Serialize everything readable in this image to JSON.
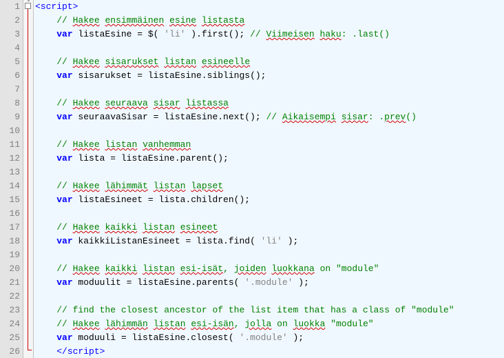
{
  "lines": [
    {
      "num": 1,
      "segs": [
        {
          "cls": "t-tag",
          "txt": "<script>"
        }
      ]
    },
    {
      "num": 2,
      "segs": [
        {
          "cls": "t-plain",
          "txt": "    "
        },
        {
          "cls": "t-com",
          "txt": "// "
        },
        {
          "cls": "t-com squiggle",
          "txt": "Hakee"
        },
        {
          "cls": "t-com",
          "txt": " "
        },
        {
          "cls": "t-com squiggle",
          "txt": "ensimmäinen"
        },
        {
          "cls": "t-com",
          "txt": " "
        },
        {
          "cls": "t-com squiggle",
          "txt": "esine"
        },
        {
          "cls": "t-com",
          "txt": " "
        },
        {
          "cls": "t-com squiggle",
          "txt": "listasta"
        }
      ]
    },
    {
      "num": 3,
      "segs": [
        {
          "cls": "t-plain",
          "txt": "    "
        },
        {
          "cls": "t-key",
          "txt": "var"
        },
        {
          "cls": "t-plain",
          "txt": " listaEsine = $( "
        },
        {
          "cls": "t-str",
          "txt": "'li'"
        },
        {
          "cls": "t-plain",
          "txt": " ).first(); "
        },
        {
          "cls": "t-com",
          "txt": "// "
        },
        {
          "cls": "t-com squiggle",
          "txt": "Viimeisen"
        },
        {
          "cls": "t-com",
          "txt": " "
        },
        {
          "cls": "t-com squiggle",
          "txt": "haku"
        },
        {
          "cls": "t-com",
          "txt": ": .last()"
        }
      ]
    },
    {
      "num": 4,
      "segs": [
        {
          "cls": "t-plain",
          "txt": ""
        }
      ]
    },
    {
      "num": 5,
      "segs": [
        {
          "cls": "t-plain",
          "txt": "    "
        },
        {
          "cls": "t-com",
          "txt": "// "
        },
        {
          "cls": "t-com squiggle",
          "txt": "Hakee"
        },
        {
          "cls": "t-com",
          "txt": " "
        },
        {
          "cls": "t-com squiggle",
          "txt": "sisarukset"
        },
        {
          "cls": "t-com",
          "txt": " "
        },
        {
          "cls": "t-com squiggle",
          "txt": "listan"
        },
        {
          "cls": "t-com",
          "txt": " "
        },
        {
          "cls": "t-com squiggle",
          "txt": "esineelle"
        }
      ]
    },
    {
      "num": 6,
      "segs": [
        {
          "cls": "t-plain",
          "txt": "    "
        },
        {
          "cls": "t-key",
          "txt": "var"
        },
        {
          "cls": "t-plain",
          "txt": " sisarukset = listaEsine.siblings();"
        }
      ]
    },
    {
      "num": 7,
      "segs": [
        {
          "cls": "t-plain",
          "txt": ""
        }
      ]
    },
    {
      "num": 8,
      "segs": [
        {
          "cls": "t-plain",
          "txt": "    "
        },
        {
          "cls": "t-com",
          "txt": "// "
        },
        {
          "cls": "t-com squiggle",
          "txt": "Hakee"
        },
        {
          "cls": "t-com",
          "txt": " "
        },
        {
          "cls": "t-com squiggle",
          "txt": "seuraava"
        },
        {
          "cls": "t-com",
          "txt": " "
        },
        {
          "cls": "t-com squiggle",
          "txt": "sisar"
        },
        {
          "cls": "t-com",
          "txt": " "
        },
        {
          "cls": "t-com squiggle",
          "txt": "listassa"
        }
      ]
    },
    {
      "num": 9,
      "segs": [
        {
          "cls": "t-plain",
          "txt": "    "
        },
        {
          "cls": "t-key",
          "txt": "var"
        },
        {
          "cls": "t-plain",
          "txt": " seuraavaSisar = listaEsine.next(); "
        },
        {
          "cls": "t-com",
          "txt": "// "
        },
        {
          "cls": "t-com squiggle",
          "txt": "Aikaisempi"
        },
        {
          "cls": "t-com",
          "txt": " "
        },
        {
          "cls": "t-com squiggle",
          "txt": "sisar"
        },
        {
          "cls": "t-com",
          "txt": ": ."
        },
        {
          "cls": "t-com squiggle",
          "txt": "prev"
        },
        {
          "cls": "t-com",
          "txt": "()"
        }
      ]
    },
    {
      "num": 10,
      "segs": [
        {
          "cls": "t-plain",
          "txt": ""
        }
      ]
    },
    {
      "num": 11,
      "segs": [
        {
          "cls": "t-plain",
          "txt": "    "
        },
        {
          "cls": "t-com",
          "txt": "// "
        },
        {
          "cls": "t-com squiggle",
          "txt": "Hakee"
        },
        {
          "cls": "t-com",
          "txt": " "
        },
        {
          "cls": "t-com squiggle",
          "txt": "listan"
        },
        {
          "cls": "t-com",
          "txt": " "
        },
        {
          "cls": "t-com squiggle",
          "txt": "vanhemman"
        }
      ]
    },
    {
      "num": 12,
      "segs": [
        {
          "cls": "t-plain",
          "txt": "    "
        },
        {
          "cls": "t-key",
          "txt": "var"
        },
        {
          "cls": "t-plain",
          "txt": " lista = listaEsine.parent();"
        }
      ]
    },
    {
      "num": 13,
      "segs": [
        {
          "cls": "t-plain",
          "txt": ""
        }
      ]
    },
    {
      "num": 14,
      "segs": [
        {
          "cls": "t-plain",
          "txt": "    "
        },
        {
          "cls": "t-com",
          "txt": "// "
        },
        {
          "cls": "t-com squiggle",
          "txt": "Hakee"
        },
        {
          "cls": "t-com",
          "txt": " "
        },
        {
          "cls": "t-com squiggle",
          "txt": "lähimmät"
        },
        {
          "cls": "t-com",
          "txt": " "
        },
        {
          "cls": "t-com squiggle",
          "txt": "listan"
        },
        {
          "cls": "t-com",
          "txt": " "
        },
        {
          "cls": "t-com squiggle",
          "txt": "lapset"
        }
      ]
    },
    {
      "num": 15,
      "segs": [
        {
          "cls": "t-plain",
          "txt": "    "
        },
        {
          "cls": "t-key",
          "txt": "var"
        },
        {
          "cls": "t-plain",
          "txt": " listaEsineet = lista.children();"
        }
      ]
    },
    {
      "num": 16,
      "segs": [
        {
          "cls": "t-plain",
          "txt": ""
        }
      ]
    },
    {
      "num": 17,
      "segs": [
        {
          "cls": "t-plain",
          "txt": "    "
        },
        {
          "cls": "t-com",
          "txt": "// "
        },
        {
          "cls": "t-com squiggle",
          "txt": "Hakee"
        },
        {
          "cls": "t-com",
          "txt": " "
        },
        {
          "cls": "t-com squiggle",
          "txt": "kaikki"
        },
        {
          "cls": "t-com",
          "txt": " "
        },
        {
          "cls": "t-com squiggle",
          "txt": "listan"
        },
        {
          "cls": "t-com",
          "txt": " "
        },
        {
          "cls": "t-com squiggle",
          "txt": "esineet"
        }
      ]
    },
    {
      "num": 18,
      "segs": [
        {
          "cls": "t-plain",
          "txt": "    "
        },
        {
          "cls": "t-key",
          "txt": "var"
        },
        {
          "cls": "t-plain",
          "txt": " kaikkiListanEsineet = lista.find( "
        },
        {
          "cls": "t-str",
          "txt": "'li'"
        },
        {
          "cls": "t-plain",
          "txt": " );"
        }
      ]
    },
    {
      "num": 19,
      "segs": [
        {
          "cls": "t-plain",
          "txt": ""
        }
      ]
    },
    {
      "num": 20,
      "segs": [
        {
          "cls": "t-plain",
          "txt": "    "
        },
        {
          "cls": "t-com",
          "txt": "// "
        },
        {
          "cls": "t-com squiggle",
          "txt": "Hakee"
        },
        {
          "cls": "t-com",
          "txt": " "
        },
        {
          "cls": "t-com squiggle",
          "txt": "kaikki"
        },
        {
          "cls": "t-com",
          "txt": " "
        },
        {
          "cls": "t-com squiggle",
          "txt": "listan"
        },
        {
          "cls": "t-com",
          "txt": " "
        },
        {
          "cls": "t-com squiggle",
          "txt": "esi-isät"
        },
        {
          "cls": "t-com",
          "txt": ", "
        },
        {
          "cls": "t-com squiggle",
          "txt": "joiden"
        },
        {
          "cls": "t-com",
          "txt": " "
        },
        {
          "cls": "t-com squiggle",
          "txt": "luokkana"
        },
        {
          "cls": "t-com",
          "txt": " on \"module\""
        }
      ]
    },
    {
      "num": 21,
      "segs": [
        {
          "cls": "t-plain",
          "txt": "    "
        },
        {
          "cls": "t-key",
          "txt": "var"
        },
        {
          "cls": "t-plain",
          "txt": " moduulit = listaEsine.parents( "
        },
        {
          "cls": "t-str",
          "txt": "'.module'"
        },
        {
          "cls": "t-plain",
          "txt": " );"
        }
      ]
    },
    {
      "num": 22,
      "segs": [
        {
          "cls": "t-plain",
          "txt": ""
        }
      ]
    },
    {
      "num": 23,
      "segs": [
        {
          "cls": "t-plain",
          "txt": "    "
        },
        {
          "cls": "t-com",
          "txt": "// find the closest ancestor of the list item that has a class of \"module\""
        }
      ]
    },
    {
      "num": 24,
      "segs": [
        {
          "cls": "t-plain",
          "txt": "    "
        },
        {
          "cls": "t-com",
          "txt": "// "
        },
        {
          "cls": "t-com squiggle",
          "txt": "Hakee"
        },
        {
          "cls": "t-com",
          "txt": " "
        },
        {
          "cls": "t-com squiggle",
          "txt": "lähimmän"
        },
        {
          "cls": "t-com",
          "txt": " "
        },
        {
          "cls": "t-com squiggle",
          "txt": "listan"
        },
        {
          "cls": "t-com",
          "txt": " "
        },
        {
          "cls": "t-com squiggle",
          "txt": "esi-isän"
        },
        {
          "cls": "t-com",
          "txt": ", "
        },
        {
          "cls": "t-com squiggle",
          "txt": "jolla"
        },
        {
          "cls": "t-com",
          "txt": " on "
        },
        {
          "cls": "t-com squiggle",
          "txt": "luokka"
        },
        {
          "cls": "t-com",
          "txt": " \"module\""
        }
      ]
    },
    {
      "num": 25,
      "segs": [
        {
          "cls": "t-plain",
          "txt": "    "
        },
        {
          "cls": "t-key",
          "txt": "var"
        },
        {
          "cls": "t-plain",
          "txt": " moduuli = listaEsine.closest( "
        },
        {
          "cls": "t-str",
          "txt": "'.module'"
        },
        {
          "cls": "t-plain",
          "txt": " );"
        }
      ]
    },
    {
      "num": 26,
      "segs": [
        {
          "cls": "t-plain",
          "txt": "    "
        },
        {
          "cls": "t-tag",
          "txt": "</script>"
        }
      ]
    }
  ]
}
